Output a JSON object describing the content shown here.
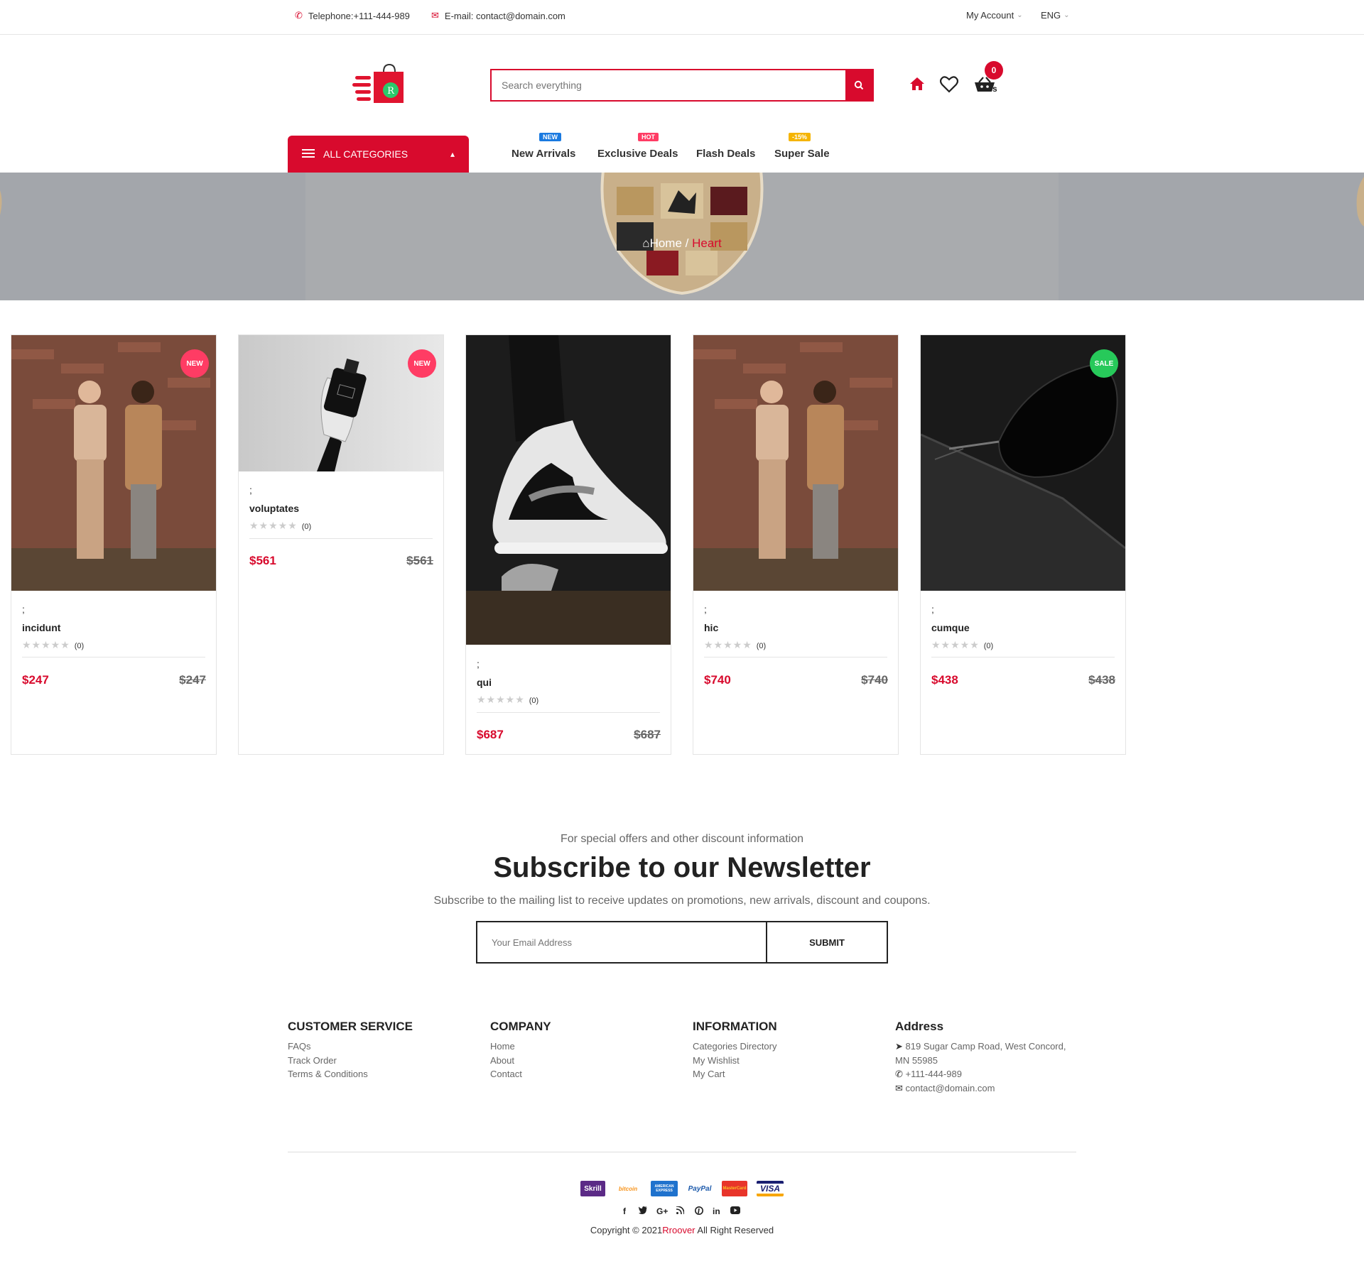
{
  "topbar": {
    "phone": "Telephone:+111-444-989",
    "email": "E-mail: contact@domain.com",
    "account": "My Account",
    "language": "ENG"
  },
  "header": {
    "search_placeholder": "Search everything",
    "cart_count": "0",
    "categories_label": "ALL CATEGORIES",
    "nav": [
      {
        "label": "New Arrivals",
        "tag": "NEW",
        "tag_color": "#1a7ae0"
      },
      {
        "label": "Exclusive Deals",
        "tag": "HOT",
        "tag_color": "#ff3c64"
      },
      {
        "label": "Flash Deals",
        "tag": "",
        "tag_color": ""
      },
      {
        "label": "Super Sale",
        "tag": "-15%",
        "tag_color": "#f5b400"
      }
    ]
  },
  "hero": {
    "crumb_home": "Home",
    "crumb_sep": " / ",
    "crumb_current": "Heart"
  },
  "products": [
    {
      "badge": "NEW",
      "semi": ";",
      "name": "incidunt",
      "stars": "★★★★★",
      "reviews": "(0)",
      "price": "$247",
      "old_price": "$247"
    },
    {
      "badge": "NEW",
      "semi": ";",
      "name": "voluptates",
      "stars": "★★★★★",
      "reviews": "(0)",
      "price": "$561",
      "old_price": "$561"
    },
    {
      "badge": "",
      "semi": ";",
      "name": "qui",
      "stars": "★★★★★",
      "reviews": "(0)",
      "price": "$687",
      "old_price": "$687"
    },
    {
      "badge": "",
      "semi": ";",
      "name": "hic",
      "stars": "★★★★★",
      "reviews": "(0)",
      "price": "$740",
      "old_price": "$740"
    },
    {
      "badge": "SALE",
      "semi": ";",
      "name": "cumque",
      "stars": "★★★★★",
      "reviews": "(0)",
      "price": "$438",
      "old_price": "$438"
    }
  ],
  "newsletter": {
    "kicker": "For special offers and other discount information",
    "title": "Subscribe to our Newsletter",
    "subtitle": "Subscribe to the mailing list to receive updates on promotions, new arrivals, discount and coupons.",
    "placeholder": "Your Email Address",
    "submit": "SUBMIT"
  },
  "footer": {
    "customer_service": {
      "title": "CUSTOMER SERVICE",
      "links": [
        "FAQs",
        "Track Order",
        "Terms & Conditions"
      ]
    },
    "company": {
      "title": "COMPANY",
      "links": [
        "Home",
        "About",
        "Contact"
      ]
    },
    "information": {
      "title": "INFORMATION",
      "links": [
        "Categories Directory",
        "My Wishlist",
        "My Cart"
      ]
    },
    "address": {
      "title": "Address",
      "street": "819 Sugar Camp Road, West Concord,",
      "city": "MN 55985",
      "phone": "+111-444-989",
      "email": "contact@domain.com"
    },
    "payments": [
      "Skrill",
      "bitcoin",
      "AMERICAN EXPRESS",
      "PayPal",
      "MasterCard",
      "VISA"
    ],
    "copyright_prefix": "Copyright © 2021",
    "brand": "Rroover",
    "copyright_suffix": " All Right Reserved"
  },
  "colors": {
    "accent": "#d80a2d",
    "new_badge": "#ff3c64",
    "sale_badge": "#27c95a"
  }
}
